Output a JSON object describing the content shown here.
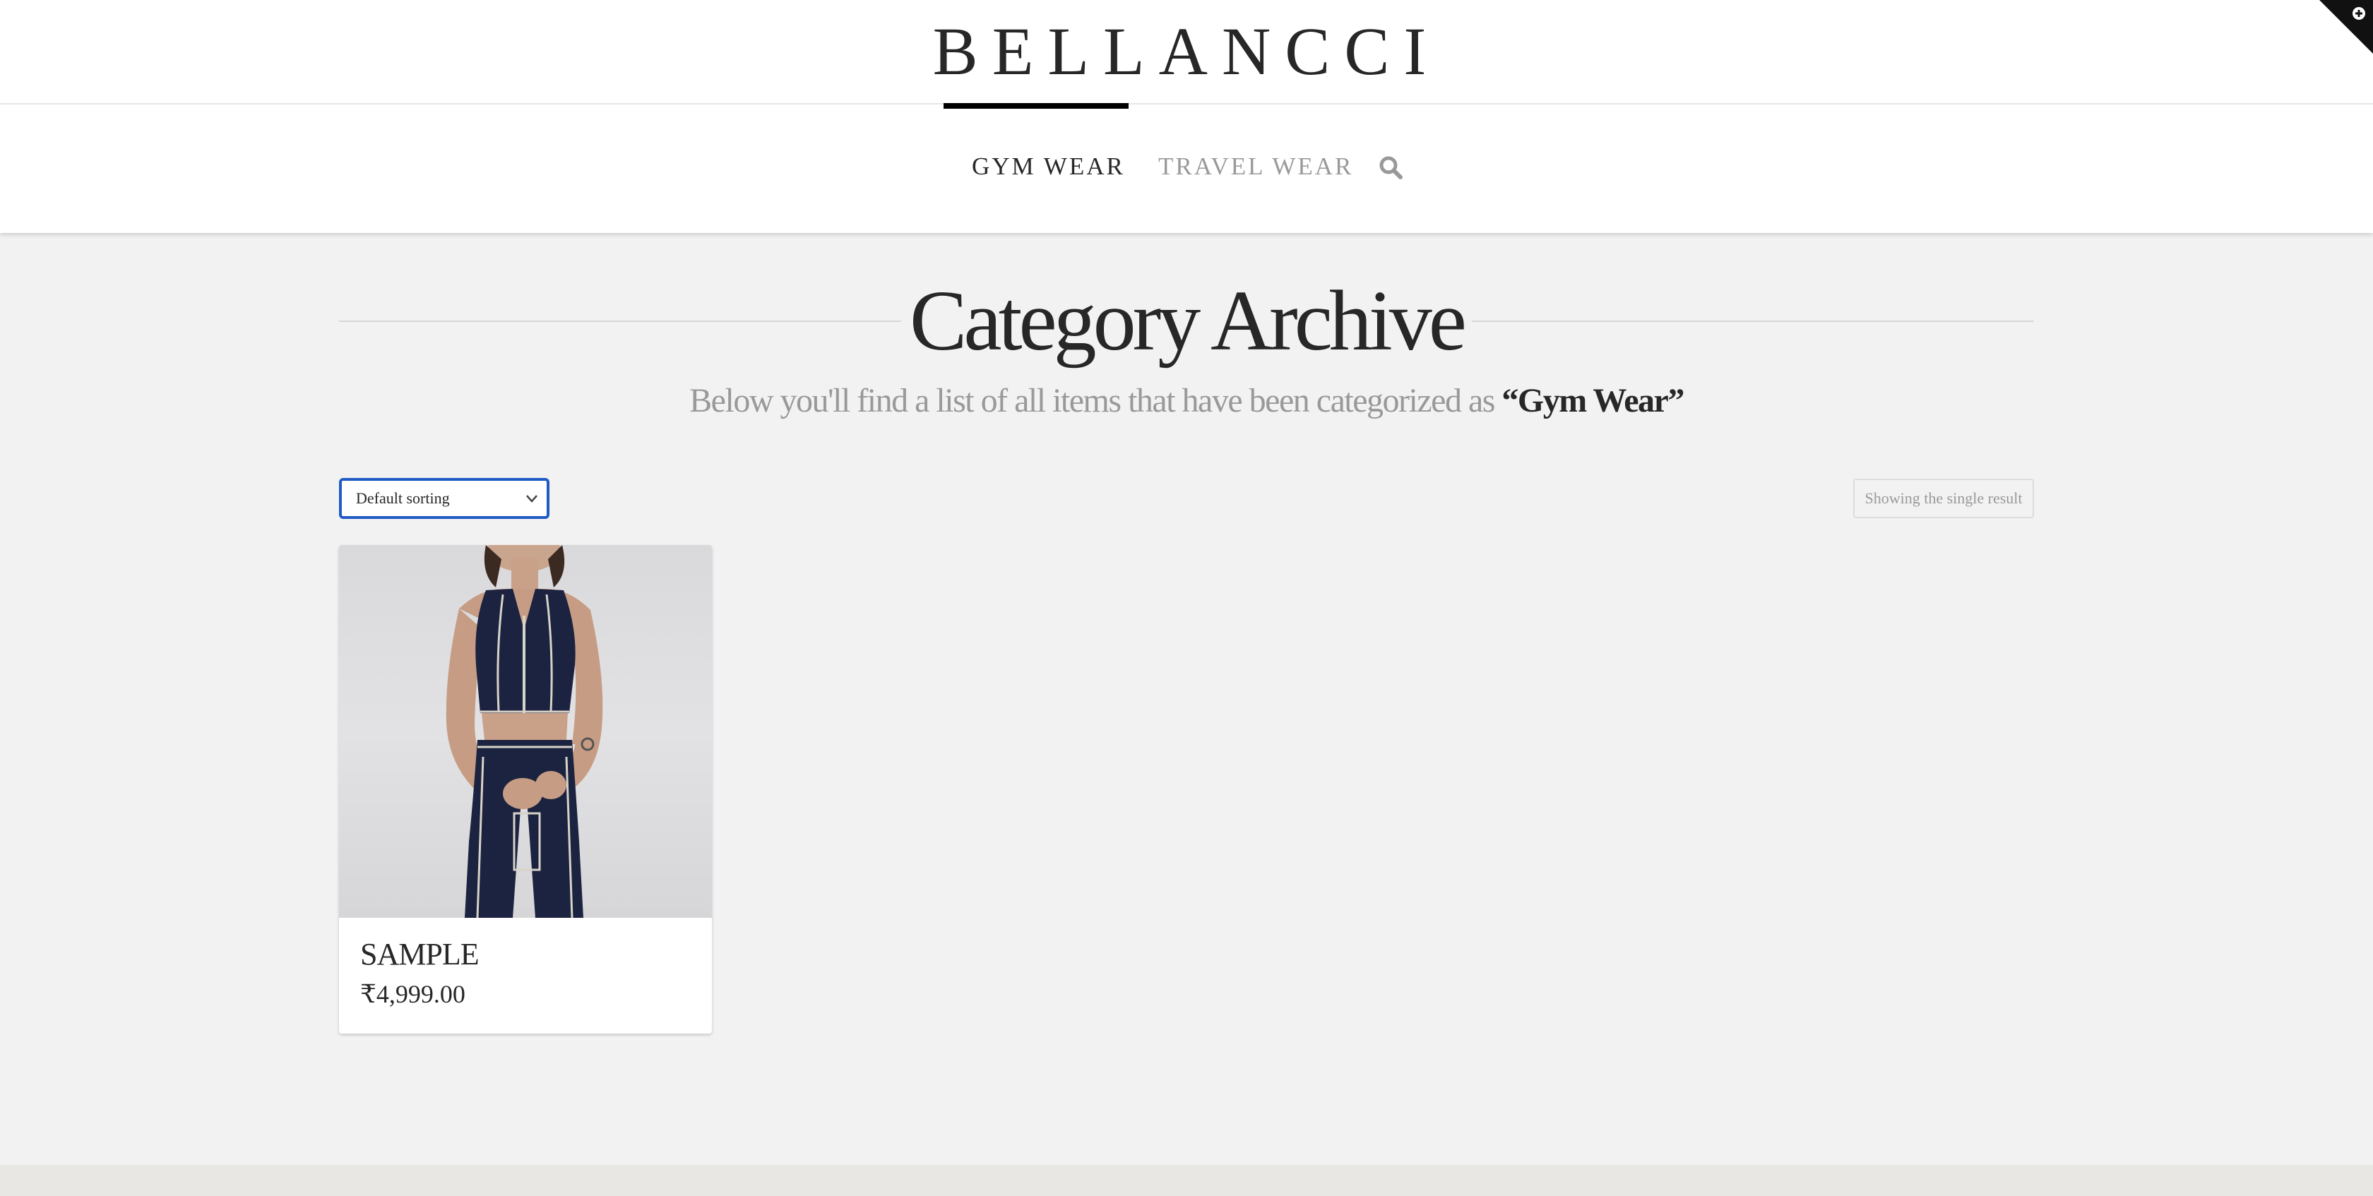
{
  "header": {
    "brand": "BELLANCCI",
    "nav": {
      "gym_wear": "GYM WEAR",
      "travel_wear": "TRAVEL WEAR",
      "search_icon": "search-icon"
    },
    "corner_icon": "plus-circle-icon"
  },
  "landmarks": {
    "title": "Category Archive",
    "subtitle_prefix": "Below you'll find a list of all items that have been categorized as ",
    "subtitle_category": "“Gym Wear”"
  },
  "toolbar": {
    "sort_selected": "Default sorting",
    "result_count": "Showing the single result"
  },
  "products": [
    {
      "title": "SAMPLE",
      "price": "₹4,999.00",
      "image_icon": "product-photo"
    }
  ],
  "colors": {
    "page_bg": "#f2f2f2",
    "text_dark": "#272727",
    "text_muted": "#999999",
    "select_focus": "#1f5bc3",
    "nav_active_bar": "#000000"
  }
}
